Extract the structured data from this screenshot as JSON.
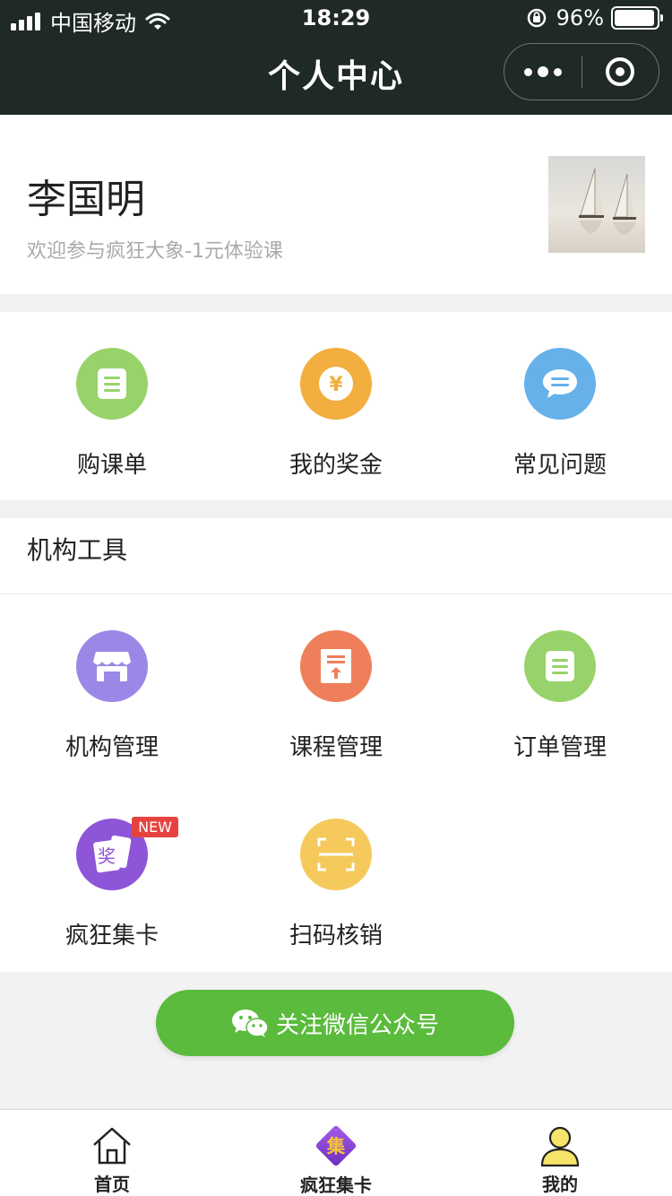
{
  "status": {
    "carrier": "中国移动",
    "time": "18:29",
    "battery": "96%",
    "battery_level": 0.96
  },
  "nav": {
    "title": "个人中心"
  },
  "profile": {
    "name": "李国明",
    "subtitle": "欢迎参与疯狂大象-1元体验课"
  },
  "quick": [
    {
      "label": "购课单",
      "icon": "list-icon",
      "color": "#97d36a"
    },
    {
      "label": "我的奖金",
      "icon": "yen-icon",
      "color": "#f2ae3e"
    },
    {
      "label": "常见问题",
      "icon": "chat-icon",
      "color": "#66b1ea"
    }
  ],
  "tools": {
    "title": "机构工具",
    "items": [
      {
        "label": "机构管理",
        "icon": "store-icon",
        "color": "#9b87e6"
      },
      {
        "label": "课程管理",
        "icon": "upload-doc-icon",
        "color": "#ee7f5a"
      },
      {
        "label": "订单管理",
        "icon": "list-icon",
        "color": "#97d36a"
      },
      {
        "label": "疯狂集卡",
        "icon": "card-icon",
        "color": "#8e55d8",
        "badge": "NEW",
        "card_char": "奖"
      },
      {
        "label": "扫码核销",
        "icon": "scan-icon",
        "color": "#f5c95c"
      }
    ]
  },
  "follow_button": {
    "label": "关注微信公众号"
  },
  "tabbar": [
    {
      "label": "首页",
      "icon": "home-icon"
    },
    {
      "label": "疯狂集卡",
      "icon": "collect-card-icon",
      "char": "集"
    },
    {
      "label": "我的",
      "icon": "user-icon"
    }
  ]
}
